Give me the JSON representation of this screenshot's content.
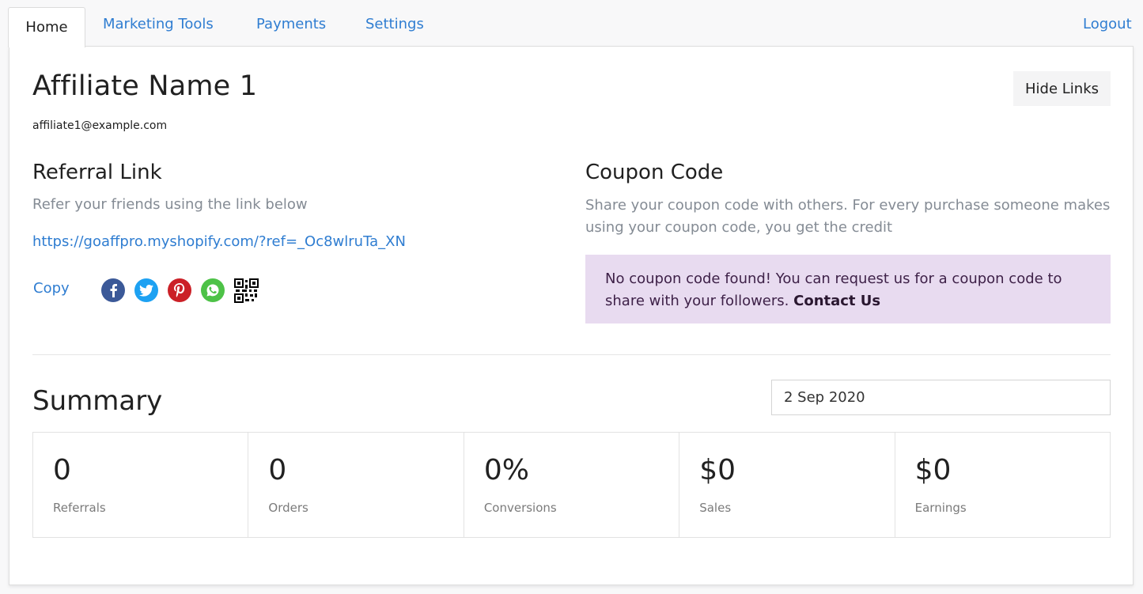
{
  "nav": {
    "tabs": [
      {
        "label": "Home",
        "active": true
      },
      {
        "label": "Marketing Tools"
      },
      {
        "label": "Payments"
      },
      {
        "label": "Settings"
      }
    ],
    "logout_label": "Logout"
  },
  "profile": {
    "name": "Affiliate Name 1",
    "email": "affiliate1@example.com",
    "hide_links_label": "Hide Links"
  },
  "referral": {
    "title": "Referral Link",
    "subtitle": "Refer your friends using the link below",
    "url": "https://goaffpro.myshopify.com/?ref=_Oc8wlruTa_XN",
    "copy_label": "Copy",
    "share_icons": [
      "facebook-icon",
      "twitter-icon",
      "pinterest-icon",
      "whatsapp-icon",
      "qr-code-icon"
    ]
  },
  "coupon": {
    "title": "Coupon Code",
    "description": "Share your coupon code with others. For every purchase someone makes using your coupon code, you get the credit",
    "alert_text": "No coupon code found! You can request us for a coupon code to share with your followers.",
    "contact_label": "Contact Us"
  },
  "summary": {
    "title": "Summary",
    "date_value": "2 Sep 2020",
    "stats": [
      {
        "value": "0",
        "label": "Referrals"
      },
      {
        "value": "0",
        "label": "Orders"
      },
      {
        "value": "0%",
        "label": "Conversions"
      },
      {
        "value": "$0",
        "label": "Sales"
      },
      {
        "value": "$0",
        "label": "Earnings"
      }
    ]
  },
  "colors": {
    "accent": "#2f7dd1",
    "alert_bg": "#e8dbf0",
    "facebook": "#3b5998",
    "twitter": "#1da1f2",
    "pinterest": "#cb2027",
    "whatsapp": "#4dc247"
  }
}
